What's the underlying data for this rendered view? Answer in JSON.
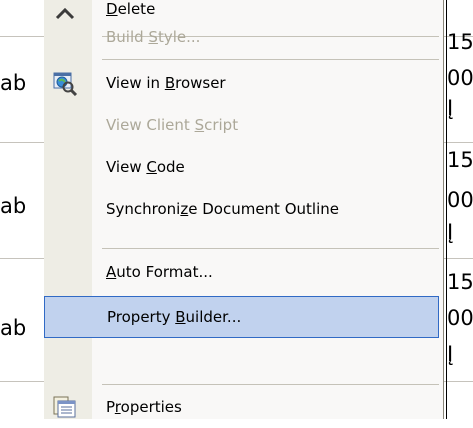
{
  "background": {
    "rows": [
      {
        "left_text": "ab",
        "right_lines": [
          "15",
          "00",
          "Į"
        ]
      },
      {
        "left_text": "ab",
        "right_lines": [
          "15",
          "00",
          "Į"
        ]
      },
      {
        "left_text": "ab",
        "right_lines": [
          "15",
          "00",
          "Į"
        ]
      }
    ]
  },
  "menu": {
    "items": [
      {
        "before": "",
        "accel": "D",
        "after": "elete",
        "enabled": true,
        "selected": false,
        "icon": "delete-x-icon"
      },
      {
        "before": "Build ",
        "accel": "S",
        "after": "tyle...",
        "enabled": false,
        "selected": false,
        "icon": ""
      },
      {
        "before": "View in ",
        "accel": "B",
        "after": "rowser",
        "enabled": true,
        "selected": false,
        "icon": "view-in-browser-icon"
      },
      {
        "before": "View Client ",
        "accel": "S",
        "after": "cript",
        "enabled": false,
        "selected": false,
        "icon": ""
      },
      {
        "before": "View ",
        "accel": "C",
        "after": "ode",
        "enabled": true,
        "selected": false,
        "icon": ""
      },
      {
        "before": "Synchroni",
        "accel": "z",
        "after": "e Document Outline",
        "enabled": true,
        "selected": false,
        "icon": ""
      },
      {
        "before": "",
        "accel": "A",
        "after": "uto Format...",
        "enabled": true,
        "selected": false,
        "icon": ""
      },
      {
        "before": "Property ",
        "accel": "B",
        "after": "uilder...",
        "enabled": true,
        "selected": true,
        "icon": ""
      },
      {
        "before": "P",
        "accel": "r",
        "after": "operties",
        "enabled": true,
        "selected": false,
        "icon": "properties-icon"
      }
    ]
  },
  "colors": {
    "selection_fill": "#c1d2ee",
    "selection_border": "#316ac5",
    "disabled_text": "#aca899",
    "gutter": "#eeede5"
  }
}
